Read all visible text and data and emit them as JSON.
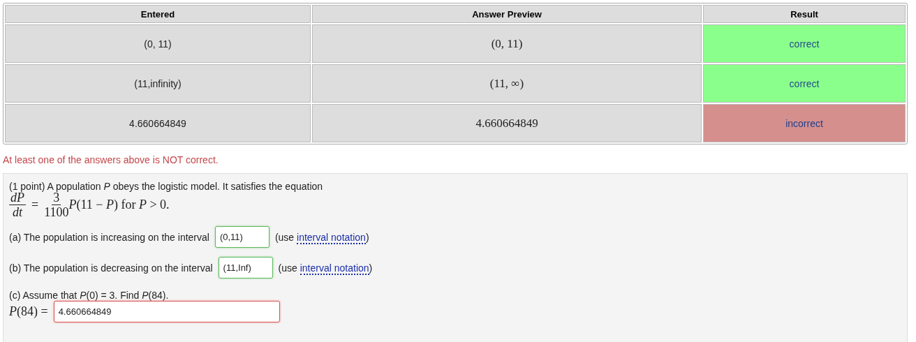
{
  "results_table": {
    "columns": [
      "Entered",
      "Answer Preview",
      "Result"
    ],
    "rows": [
      {
        "entered": "(0, 11)",
        "preview": "(0, 11)",
        "result": "correct",
        "correct": true
      },
      {
        "entered": "(11,infinity)",
        "preview": "(11, ∞)",
        "result": "correct",
        "correct": true
      },
      {
        "entered": "4.660664849",
        "preview": "4.660664849",
        "result": "incorrect",
        "correct": false
      }
    ]
  },
  "message": "At least one of the answers above is NOT correct.",
  "problem": {
    "intro": "(1 point) A population *P* obeys the logistic model. It satisfies the equation",
    "equation": {
      "lhs_numerator": "dP",
      "lhs_denominator": "dt",
      "equals": "=",
      "rhs_numerator": "3",
      "rhs_denominator": "1100",
      "tail": "*P*(11 − *P*) for *P* > 0."
    },
    "parts": [
      {
        "kind": "interval",
        "prompt": "(a) The population is increasing on the interval",
        "value": "(0,11)",
        "correct": true,
        "hint_before": "(use ",
        "hint_link": "interval notation",
        "hint_after": ")"
      },
      {
        "kind": "interval",
        "prompt": "(b) The population is decreasing on the interval",
        "value": "(11,Inf)",
        "correct": true,
        "hint_before": "(use ",
        "hint_link": "interval notation",
        "hint_after": ")"
      },
      {
        "kind": "value",
        "prompt": "(c) Assume that *P*(0) = 3. Find *P*(84).",
        "label": "*P*(84) =",
        "value": "4.660664849",
        "correct": false
      }
    ]
  }
}
